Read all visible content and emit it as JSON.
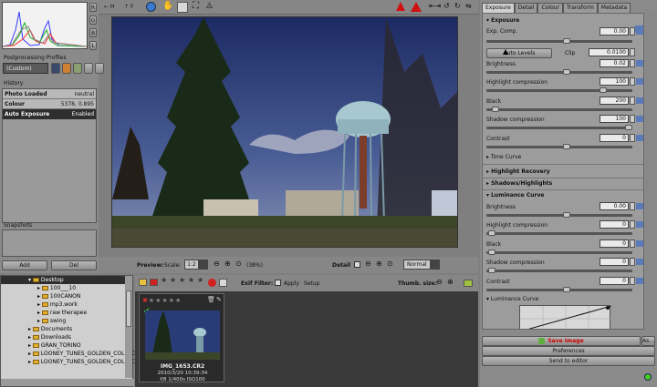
{
  "left": {
    "histogram_buttons": [
      "R",
      "G",
      "B",
      "L"
    ],
    "pp_profiles_label": "Postprocessing Profiles",
    "pp_profile_value": "(Custom)",
    "history_label": "History",
    "history": [
      {
        "name": "Photo Loaded",
        "value": "neutral"
      },
      {
        "name": "Colour Temperature",
        "value": "5378, 0.895"
      },
      {
        "name": "Auto Exposure",
        "value": "Enabled"
      }
    ],
    "snapshots_label": "Snapshots",
    "add_label": "Add",
    "del_label": "Del"
  },
  "toolbar": {
    "history_btn": "H",
    "film_btn": "F"
  },
  "preview": {
    "label": "Preview:",
    "scale_label": "Scale:",
    "scale_value": "1:2",
    "zoom_percent": "(38%)",
    "detail_label": "Detail",
    "normal_label": "Normal"
  },
  "browser": {
    "tree": [
      {
        "label": "Desktop",
        "depth": 1,
        "selected": true
      },
      {
        "label": "100___10",
        "depth": 2
      },
      {
        "label": "100CANON",
        "depth": 2
      },
      {
        "label": "mp3.work",
        "depth": 2
      },
      {
        "label": "raw therapee",
        "depth": 2
      },
      {
        "label": "swing",
        "depth": 2
      },
      {
        "label": "Documents",
        "depth": 1
      },
      {
        "label": "Downloads",
        "depth": 1
      },
      {
        "label": "GRAN_TORINO",
        "depth": 1
      },
      {
        "label": "LOONEY_TUNES_GOLDEN_COLLECT",
        "depth": 1
      },
      {
        "label": "LOONEY_TUNES_GOLDEN_COLLECT",
        "depth": 1
      }
    ],
    "exif_filter_label": "Exif Filter:",
    "apply_label": "Apply",
    "setup_label": "Setup",
    "thumb_size_label": "Thumb. size:",
    "thumb": {
      "filename": "IMG_1653.CR2",
      "date": "2010/3/20 10:39:34",
      "exif": "f/8 1/400s ISO100"
    }
  },
  "right": {
    "tabs": [
      "Exposure",
      "Detail",
      "Colour",
      "Transform",
      "Metadata"
    ],
    "exposure_header": "Exposure",
    "exp_comp": {
      "label": "Exp. Comp.",
      "value": "0.00"
    },
    "auto_levels": "Auto Levels",
    "clip": {
      "label": "Clip",
      "value": "0.0100"
    },
    "brightness": {
      "label": "Brightness",
      "value": "0.02"
    },
    "highlight_comp": {
      "label": "Highlight compression",
      "value": "100"
    },
    "black": {
      "label": "Black",
      "value": "200"
    },
    "shadow_comp": {
      "label": "Shadow compression",
      "value": "100"
    },
    "contrast": {
      "label": "Contrast",
      "value": "0"
    },
    "tone_curve": "Tone Curve",
    "highlight_recovery": "Highlight Recovery",
    "shadows_highlights": "Shadows/Highlights",
    "luminance_curve": "Luminance Curve",
    "lum_brightness": {
      "label": "Brightness",
      "value": "0.00"
    },
    "lum_highlight": {
      "label": "Highlight compression",
      "value": "0"
    },
    "lum_black": {
      "label": "Black",
      "value": "0"
    },
    "lum_shadow": {
      "label": "Shadow compression",
      "value": "0"
    },
    "lum_contrast": {
      "label": "Contrast",
      "value": "0"
    },
    "lum_curve_label": "Luminance Curve",
    "save_image": "Save Image",
    "as_label": "As...",
    "preferences": "Preferences",
    "send_to_editor": "Send to editor"
  }
}
